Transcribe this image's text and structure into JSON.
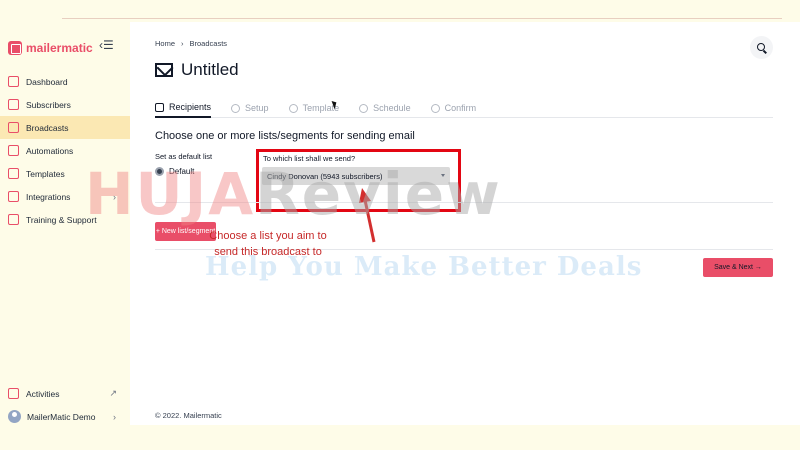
{
  "app": {
    "brand": "mailermatic"
  },
  "sidebar": {
    "items": [
      {
        "label": "Dashboard",
        "icon": "dashboard-icon"
      },
      {
        "label": "Subscribers",
        "icon": "subscribers-icon"
      },
      {
        "label": "Broadcasts",
        "icon": "broadcast-icon",
        "active": true
      },
      {
        "label": "Automations",
        "icon": "automation-icon"
      },
      {
        "label": "Templates",
        "icon": "templates-icon"
      },
      {
        "label": "Integrations",
        "icon": "integrations-icon"
      },
      {
        "label": "Training & Support",
        "icon": "support-icon"
      }
    ],
    "bottom": [
      {
        "label": "Activities",
        "icon": "activities-icon"
      },
      {
        "label": "MailerMatic Demo",
        "icon": "avatar"
      }
    ]
  },
  "breadcrumb": {
    "home": "Home",
    "separator": "›",
    "current": "Broadcasts"
  },
  "page": {
    "title": "Untitled"
  },
  "tabs": [
    {
      "label": "Recipients",
      "active": true
    },
    {
      "label": "Setup"
    },
    {
      "label": "Template"
    },
    {
      "label": "Schedule"
    },
    {
      "label": "Confirm"
    }
  ],
  "form": {
    "section_title": "Choose one or more lists/segments for sending email",
    "default_label": "Set as default list",
    "default_option": "Default",
    "list_label": "To which list shall we send?",
    "list_value": "Cindy Donovan (5943 subscribers)",
    "add_button": "+ New list/segment",
    "next_button": "Save & Next →"
  },
  "annotation": "Choose a list you aim to send this broadcast to",
  "watermark": {
    "main_red": "HUJA",
    "main_grey": "Review",
    "sub": "Help You Make Better Deals"
  },
  "footer": "© 2022. Mailermatic",
  "colors": {
    "accent": "#e94e68",
    "active_nav": "#fbe8b3",
    "highlight": "#e30613"
  }
}
